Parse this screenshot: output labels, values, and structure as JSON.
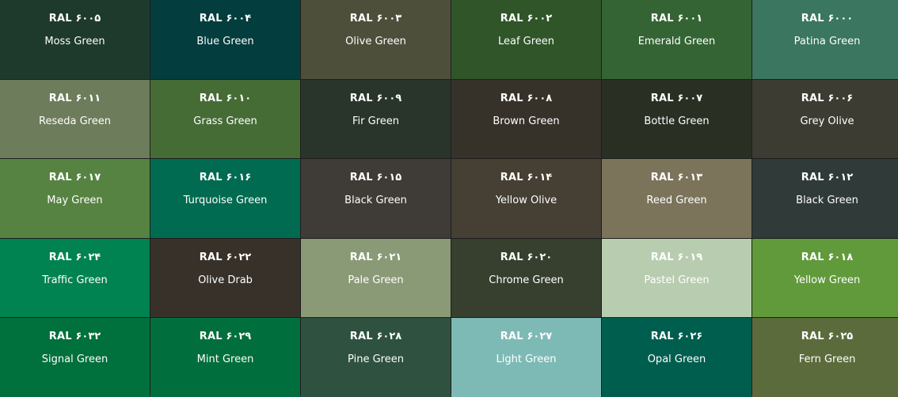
{
  "swatches": [
    {
      "code": "RAL ۶۰۰۵",
      "name": "Moss Green",
      "color": "#1e3a2c"
    },
    {
      "code": "RAL ۶۰۰۴",
      "name": "Blue Green",
      "color": "#033d3e"
    },
    {
      "code": "RAL ۶۰۰۳",
      "name": "Olive Green",
      "color": "#4d4f3b"
    },
    {
      "code": "RAL ۶۰۰۲",
      "name": "Leaf Green",
      "color": "#2f5529"
    },
    {
      "code": "RAL ۶۰۰۱",
      "name": "Emerald Green",
      "color": "#356434"
    },
    {
      "code": "RAL ۶۰۰۰",
      "name": "Patina Green",
      "color": "#3a7660"
    },
    {
      "code": "RAL ۶۰۱۱",
      "name": "Reseda Green",
      "color": "#6d7c5b"
    },
    {
      "code": "RAL ۶۰۱۰",
      "name": "Grass Green",
      "color": "#466c36"
    },
    {
      "code": "RAL ۶۰۰۹",
      "name": "Fir Green",
      "color": "#29342b"
    },
    {
      "code": "RAL ۶۰۰۸",
      "name": "Brown Green",
      "color": "#36322a"
    },
    {
      "code": "RAL ۶۰۰۷",
      "name": "Bottle Green",
      "color": "#2a2f24"
    },
    {
      "code": "RAL ۶۰۰۶",
      "name": "Grey Olive",
      "color": "#3d3c33"
    },
    {
      "code": "RAL ۶۰۱۷",
      "name": "May Green",
      "color": "#568342"
    },
    {
      "code": "RAL ۶۰۱۶",
      "name": "Turquoise Green",
      "color": "#006b51"
    },
    {
      "code": "RAL ۶۰۱۵",
      "name": "Black Green",
      "color": "#3f3b36"
    },
    {
      "code": "RAL ۶۰۱۴",
      "name": "Yellow Olive",
      "color": "#453f34"
    },
    {
      "code": "RAL ۶۰۱۳",
      "name": "Reed Green",
      "color": "#7b745b"
    },
    {
      "code": "RAL ۶۰۱۲",
      "name": "Black Green",
      "color": "#2f3a39"
    },
    {
      "code": "RAL ۶۰۲۴",
      "name": "Traffic Green",
      "color": "#008351"
    },
    {
      "code": "RAL ۶۰۲۲",
      "name": "Olive Drab",
      "color": "#37312a"
    },
    {
      "code": "RAL ۶۰۲۱",
      "name": "Pale Green",
      "color": "#8a9a76"
    },
    {
      "code": "RAL ۶۰۲۰",
      "name": "Chrome Green",
      "color": "#373f2f"
    },
    {
      "code": "RAL ۶۰۱۹",
      "name": "Pastel Green",
      "color": "#b8cdaf"
    },
    {
      "code": "RAL ۶۰۱۸",
      "name": "Yellow Green",
      "color": "#619a3b"
    },
    {
      "code": "RAL ۶۰۳۲",
      "name": "Signal Green",
      "color": "#00703c"
    },
    {
      "code": "RAL ۶۰۲۹",
      "name": "Mint Green",
      "color": "#006f3d"
    },
    {
      "code": "RAL ۶۰۲۸",
      "name": "Pine Green",
      "color": "#2e5140"
    },
    {
      "code": "RAL ۶۰۲۷",
      "name": "Light Green",
      "color": "#7ebab5"
    },
    {
      "code": "RAL ۶۰۲۶",
      "name": "Opal Green",
      "color": "#005e4f"
    },
    {
      "code": "RAL ۶۰۲۵",
      "name": "Fern Green",
      "color": "#5c6b3c"
    }
  ]
}
